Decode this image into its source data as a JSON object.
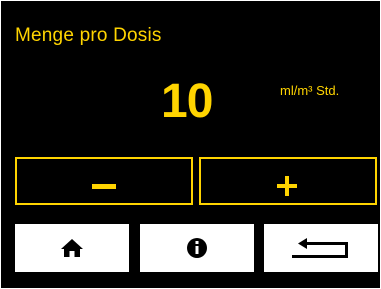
{
  "header": {
    "title": "Menge pro Dosis"
  },
  "dose": {
    "value": "10",
    "unit": "ml/m³ Std."
  },
  "controls": {
    "decrease": "decrease",
    "increase": "increase"
  },
  "nav": {
    "home_icon": "home-icon",
    "info_icon": "info-icon",
    "back_icon": "return-arrow-icon"
  },
  "colors": {
    "background": "#000000",
    "accent": "#ffd400",
    "nav_button": "#ffffff"
  }
}
